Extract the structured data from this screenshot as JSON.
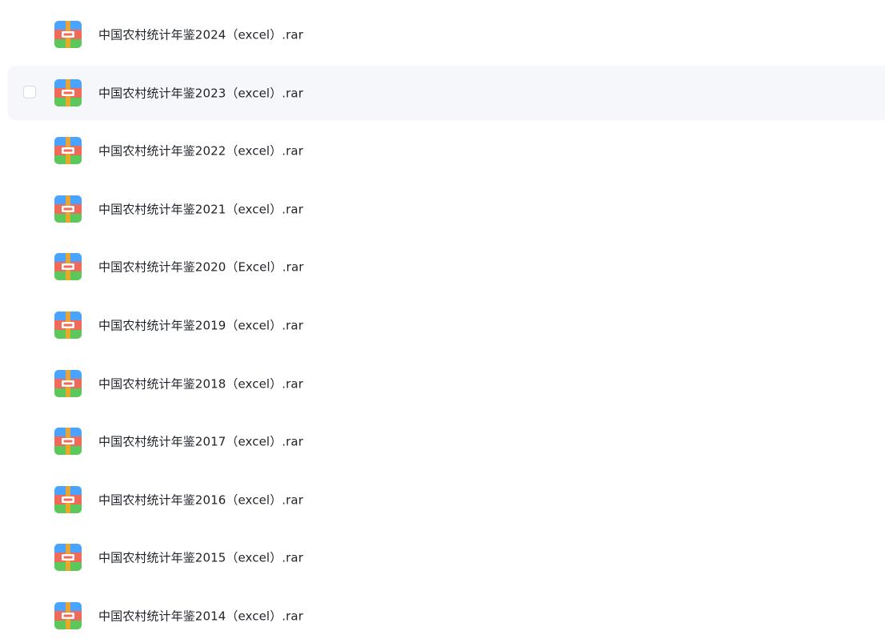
{
  "file_list": {
    "items": [
      {
        "name": "中国农村统计年鉴2024（excel）.rar",
        "icon": "rar-archive-icon",
        "hovered": false
      },
      {
        "name": "中国农村统计年鉴2023（excel）.rar",
        "icon": "rar-archive-icon",
        "hovered": true
      },
      {
        "name": "中国农村统计年鉴2022（excel）.rar",
        "icon": "rar-archive-icon",
        "hovered": false
      },
      {
        "name": "中国农村统计年鉴2021（excel）.rar",
        "icon": "rar-archive-icon",
        "hovered": false
      },
      {
        "name": "中国农村统计年鉴2020（Excel）.rar",
        "icon": "rar-archive-icon",
        "hovered": false
      },
      {
        "name": "中国农村统计年鉴2019（excel）.rar",
        "icon": "rar-archive-icon",
        "hovered": false
      },
      {
        "name": "中国农村统计年鉴2018（excel）.rar",
        "icon": "rar-archive-icon",
        "hovered": false
      },
      {
        "name": "中国农村统计年鉴2017（excel）.rar",
        "icon": "rar-archive-icon",
        "hovered": false
      },
      {
        "name": "中国农村统计年鉴2016（excel）.rar",
        "icon": "rar-archive-icon",
        "hovered": false
      },
      {
        "name": "中国农村统计年鉴2015（excel）.rar",
        "icon": "rar-archive-icon",
        "hovered": false
      },
      {
        "name": "中国农村统计年鉴2014（excel）.rar",
        "icon": "rar-archive-icon",
        "hovered": false
      }
    ]
  },
  "colors": {
    "hover_background": "#f6f7fb",
    "text": "#1f2329",
    "icon_top": "#4aa3ff",
    "icon_middle": "#f06a5a",
    "icon_bottom": "#5cc85c",
    "icon_strap": "#f5a623"
  }
}
